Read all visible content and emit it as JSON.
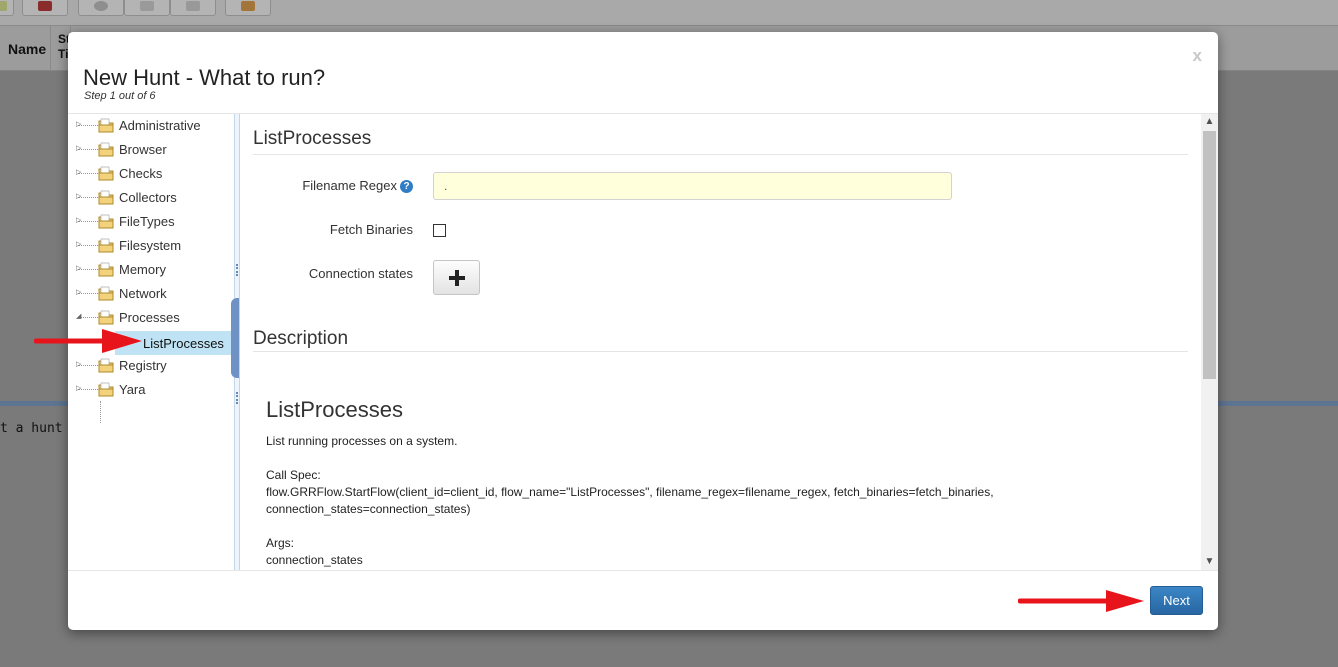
{
  "background": {
    "table_headers": [
      "Name",
      "St Ti"
    ],
    "status_text": "t a hunt to s"
  },
  "modal": {
    "close_label": "x",
    "title": "New Hunt - What to run?",
    "step_text": "Step 1 out of 6",
    "tree": {
      "items": [
        {
          "label": "Administrative"
        },
        {
          "label": "Browser"
        },
        {
          "label": "Checks"
        },
        {
          "label": "Collectors"
        },
        {
          "label": "FileTypes"
        },
        {
          "label": "Filesystem"
        },
        {
          "label": "Memory"
        },
        {
          "label": "Network"
        },
        {
          "label": "Processes",
          "expanded": true
        },
        {
          "label": "Registry"
        },
        {
          "label": "Yara"
        }
      ],
      "selected_child": "ListProcesses"
    },
    "flow_form": {
      "title": "ListProcesses",
      "filename_regex_label": "Filename Regex",
      "filename_regex_help": "?",
      "filename_regex_value": ".",
      "fetch_binaries_label": "Fetch Binaries",
      "fetch_binaries_checked": false,
      "connection_states_label": "Connection states",
      "add_icon": "plus-icon"
    },
    "description": {
      "section_title": "Description",
      "flow_name": "ListProcesses",
      "summary": "List running processes on a system.",
      "call_spec_label": "Call Spec:",
      "call_spec_line1": "flow.GRRFlow.StartFlow(client_id=client_id, flow_name=\"ListProcesses\", filename_regex=filename_regex, fetch_binaries=fetch_binaries,",
      "call_spec_line2": "connection_states=connection_states)",
      "args_label": "Args:",
      "args_line1": "connection_states"
    },
    "footer": {
      "next_label": "Next"
    }
  },
  "colors": {
    "primary_button": "#2f76b5",
    "selection": "#bfe3f4",
    "input_bg": "#ffffdc",
    "arrow": "#e8141c"
  }
}
